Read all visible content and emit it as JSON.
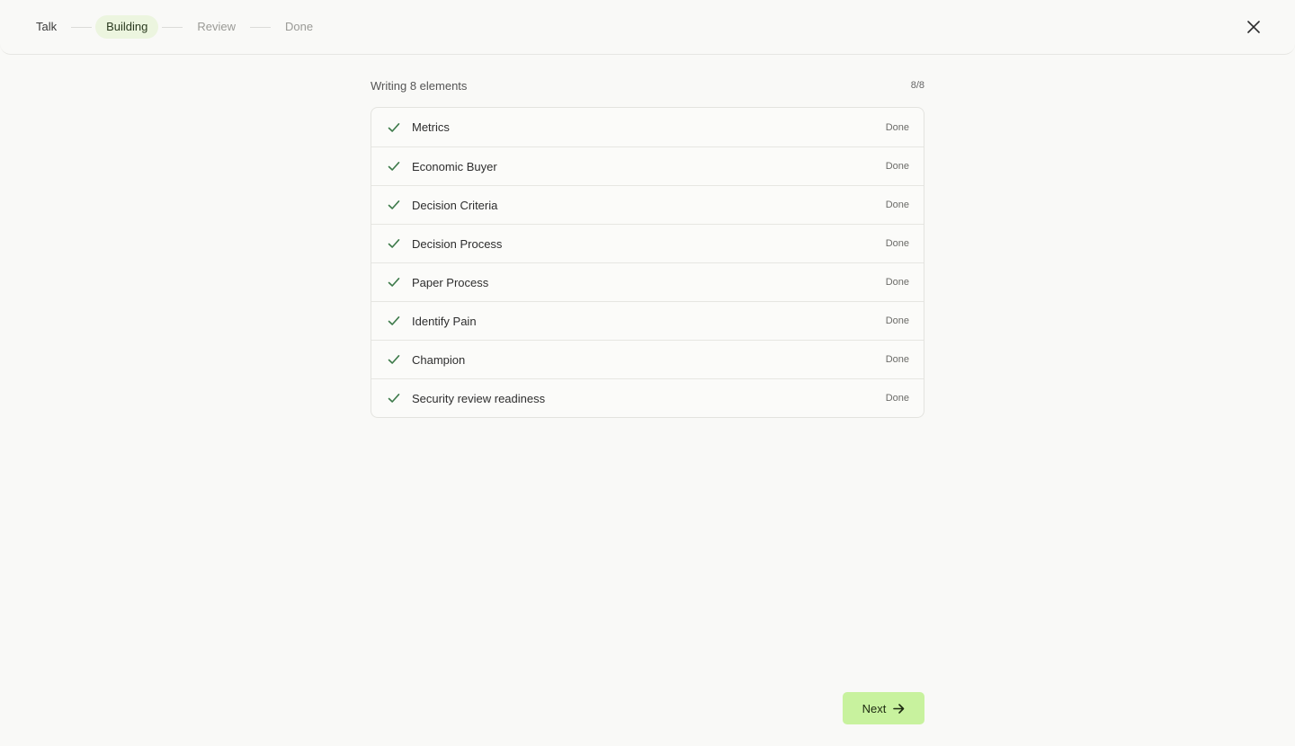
{
  "stepper": {
    "steps": [
      {
        "label": "Talk",
        "state": "done"
      },
      {
        "label": "Building",
        "state": "active"
      },
      {
        "label": "Review",
        "state": "upcoming"
      },
      {
        "label": "Done",
        "state": "upcoming"
      }
    ]
  },
  "header": {
    "close_icon": "close-icon"
  },
  "main": {
    "title": "Writing 8 elements",
    "count": "8/8",
    "items": [
      {
        "label": "Metrics",
        "status": "Done"
      },
      {
        "label": "Economic Buyer",
        "status": "Done"
      },
      {
        "label": "Decision Criteria",
        "status": "Done"
      },
      {
        "label": "Decision Process",
        "status": "Done"
      },
      {
        "label": "Paper Process",
        "status": "Done"
      },
      {
        "label": "Identify Pain",
        "status": "Done"
      },
      {
        "label": "Champion",
        "status": "Done"
      },
      {
        "label": "Security review readiness",
        "status": "Done"
      }
    ]
  },
  "footer": {
    "next_label": "Next",
    "next_icon": "arrow-right-icon"
  },
  "colors": {
    "accent": "#c8f29e",
    "active_step_bg": "#ecf5df",
    "check": "#3d7a4a",
    "background": "#f9f9f7"
  }
}
